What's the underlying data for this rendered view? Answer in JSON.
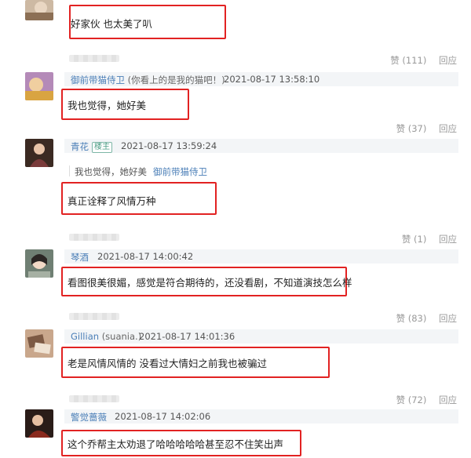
{
  "comments": [
    {
      "text": "好家伙 也太美了叭",
      "likes_label": "赞",
      "likes_count": "(111)",
      "reply_label": "回应"
    },
    {
      "user": "御前带猫侍卫",
      "extra": "(你看上的是我的猫吧！)",
      "time": "2021-08-17 13:58:10",
      "text": "我也觉得，她好美",
      "likes_label": "赞",
      "likes_count": "(37)",
      "reply_label": "回应"
    },
    {
      "user": "青花",
      "badge": "楼主",
      "time": "2021-08-17 13:59:24",
      "quote_text": "我也觉得，她好美",
      "quote_user": "御前带猫侍卫",
      "text": "真正诠释了风情万种",
      "likes_label": "赞",
      "likes_count": "(1)",
      "reply_label": "回应"
    },
    {
      "user": "琴酒",
      "time": "2021-08-17 14:00:42",
      "text": "看图很美很媚，感觉是符合期待的，还没看剧，不知道演技怎么样",
      "likes_label": "赞",
      "likes_count": "(83)",
      "reply_label": "回应"
    },
    {
      "user": "Gillian",
      "extra": "(suania.)",
      "time": "2021-08-17 14:01:36",
      "text": "老是风情风情的 没看过大情妇之前我也被骗过",
      "likes_label": "赞",
      "likes_count": "(72)",
      "reply_label": "回应"
    },
    {
      "user": "警觉蔷薇",
      "time": "2021-08-17 14:02:06",
      "text": "这个乔帮主太劝退了哈哈哈哈哈甚至忍不住笑出声"
    }
  ],
  "colors": {
    "highlight_border": "#e22222",
    "username": "#4a7eb7",
    "header_band": "#f3f5f7",
    "muted": "#999999"
  }
}
